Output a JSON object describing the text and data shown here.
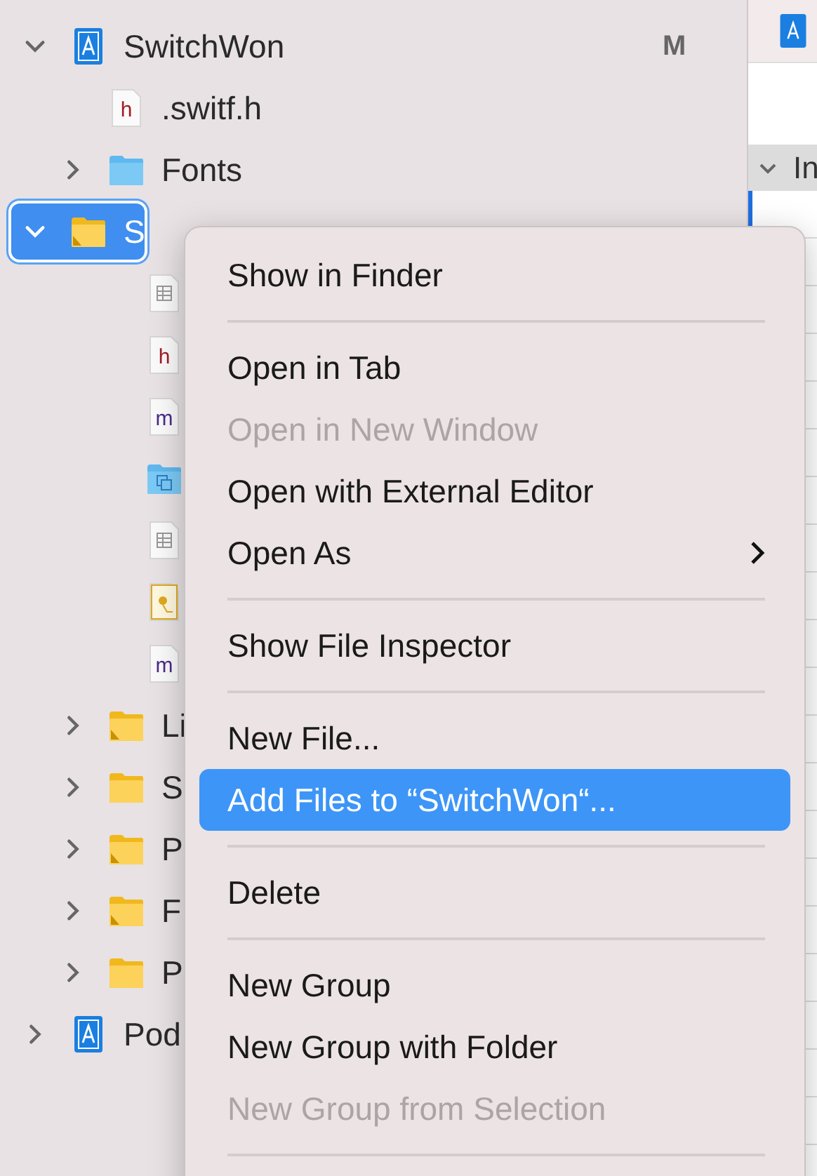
{
  "navigator": {
    "tree": [
      {
        "name": "SwitchWon",
        "kind": "project",
        "expanded": true,
        "selected": false,
        "badge": "M",
        "children": [
          {
            "name": ".switf.h",
            "kind": "file-h",
            "glyph": "h",
            "selected": false
          },
          {
            "name": "Fonts",
            "kind": "folder-blue",
            "expanded": false,
            "selected": false
          },
          {
            "name": "S",
            "kind": "folder",
            "expanded": true,
            "selected": true,
            "children": [
              {
                "kind": "file-table",
                "selected": false
              },
              {
                "kind": "file-h",
                "glyph": "h",
                "selected": false
              },
              {
                "kind": "file-m",
                "glyph": "m",
                "selected": false
              },
              {
                "kind": "folder-ref",
                "selected": false
              },
              {
                "kind": "file-table",
                "selected": false
              },
              {
                "kind": "file-asset",
                "selected": false
              },
              {
                "kind": "file-m",
                "glyph": "m",
                "selected": false
              }
            ]
          },
          {
            "name": "Li",
            "kind": "folder",
            "expanded": false,
            "selected": false
          },
          {
            "name": "S",
            "kind": "folder-plain",
            "expanded": false,
            "selected": false
          },
          {
            "name": "P",
            "kind": "folder",
            "expanded": false,
            "selected": false
          },
          {
            "name": "F",
            "kind": "folder",
            "expanded": false,
            "selected": false
          },
          {
            "name": "P",
            "kind": "folder-plain",
            "expanded": false,
            "selected": false
          }
        ]
      },
      {
        "name": "Pod",
        "kind": "project",
        "expanded": false,
        "selected": false
      }
    ]
  },
  "editor": {
    "section_header": "In"
  },
  "context_menu": [
    {
      "kind": "item",
      "label": "Show in Finder",
      "disabled": false,
      "selected": false,
      "submenu": false
    },
    {
      "kind": "separator"
    },
    {
      "kind": "item",
      "label": "Open in Tab",
      "disabled": false,
      "selected": false,
      "submenu": false
    },
    {
      "kind": "item",
      "label": "Open in New Window",
      "disabled": true,
      "selected": false,
      "submenu": false
    },
    {
      "kind": "item",
      "label": "Open with External Editor",
      "disabled": false,
      "selected": false,
      "submenu": false
    },
    {
      "kind": "item",
      "label": "Open As",
      "disabled": false,
      "selected": false,
      "submenu": true
    },
    {
      "kind": "separator"
    },
    {
      "kind": "item",
      "label": "Show File Inspector",
      "disabled": false,
      "selected": false,
      "submenu": false
    },
    {
      "kind": "separator"
    },
    {
      "kind": "item",
      "label": "New File...",
      "disabled": false,
      "selected": false,
      "submenu": false
    },
    {
      "kind": "item",
      "label": "Add Files to “SwitchWon“...",
      "disabled": false,
      "selected": true,
      "submenu": false
    },
    {
      "kind": "separator"
    },
    {
      "kind": "item",
      "label": "Delete",
      "disabled": false,
      "selected": false,
      "submenu": false
    },
    {
      "kind": "separator"
    },
    {
      "kind": "item",
      "label": "New Group",
      "disabled": false,
      "selected": false,
      "submenu": false
    },
    {
      "kind": "item",
      "label": "New Group with Folder",
      "disabled": false,
      "selected": false,
      "submenu": false
    },
    {
      "kind": "item",
      "label": "New Group from Selection",
      "disabled": true,
      "selected": false,
      "submenu": false
    },
    {
      "kind": "separator"
    }
  ]
}
